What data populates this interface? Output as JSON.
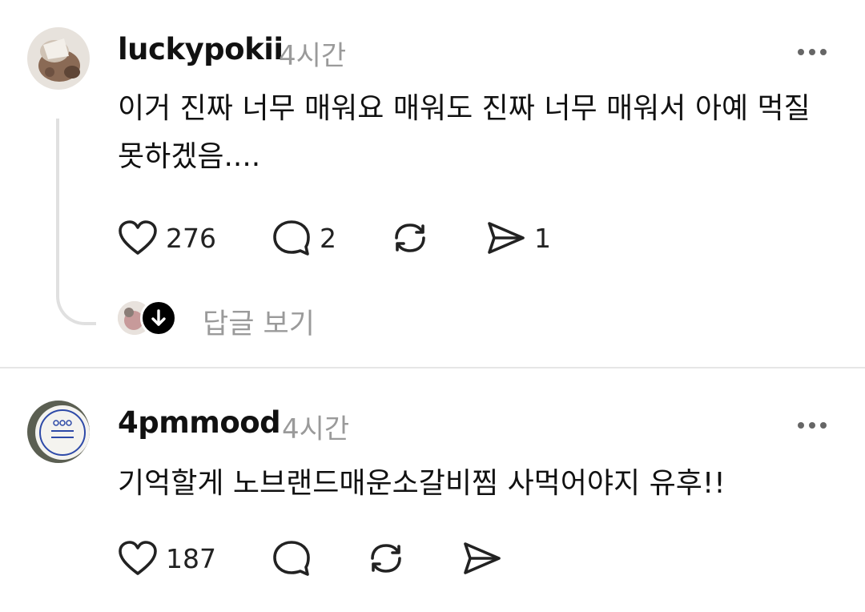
{
  "comments": [
    {
      "username": "luckypokii",
      "time": "4시간",
      "text": "이거 진짜 너무 매워요 매워도 진짜 너무 매워서 아예 먹질 못하겠음....",
      "likes": "276",
      "replies": "2",
      "reposts": "",
      "shares": "1",
      "view_replies_label": "답글 보기"
    },
    {
      "username": "4pmmood",
      "time": "4시간",
      "text": "기억할게 노브랜드매운소갈비찜 사먹어야지 유후!!",
      "likes": "187",
      "replies": "",
      "reposts": "",
      "shares": ""
    }
  ],
  "icons": {
    "more": "more-horizontal-icon",
    "like": "heart-icon",
    "reply": "comment-bubble-icon",
    "repost": "repost-icon",
    "share": "send-icon",
    "expand": "arrow-down-icon"
  },
  "colors": {
    "text": "#111111",
    "muted": "#9a9a9a",
    "divider": "#e6e6e6"
  }
}
